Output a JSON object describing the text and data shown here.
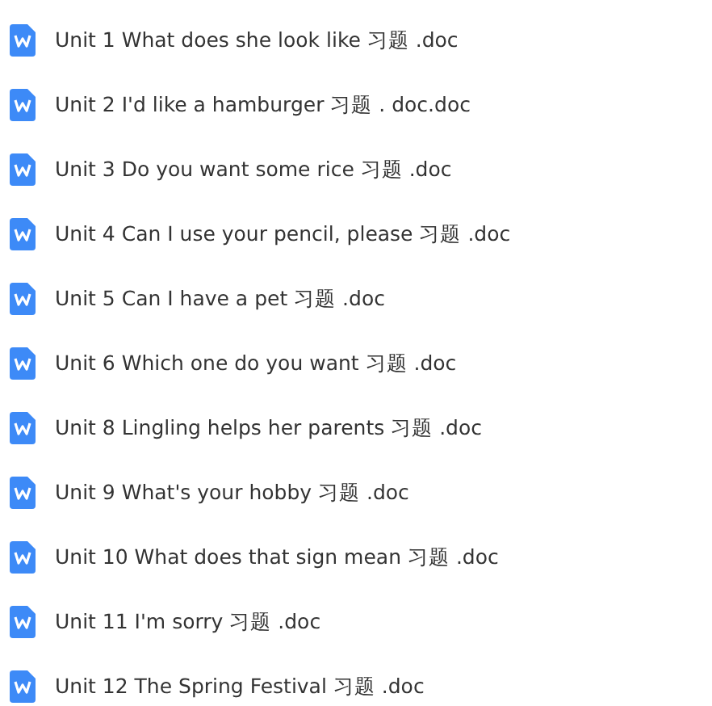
{
  "files": [
    {
      "name": "Unit 1 What does she look like 习题 .doc"
    },
    {
      "name": "Unit 2 I'd like a hamburger 习题 . doc.doc"
    },
    {
      "name": "Unit 3 Do you want some rice 习题 .doc"
    },
    {
      "name": "Unit 4 Can I use your pencil, please 习题 .doc"
    },
    {
      "name": "Unit 5 Can I have a pet 习题 .doc"
    },
    {
      "name": "Unit 6 Which one do you want 习题 .doc"
    },
    {
      "name": "Unit 8 Lingling helps her parents 习题 .doc"
    },
    {
      "name": "Unit 9 What's your hobby 习题 .doc"
    },
    {
      "name": "Unit 10 What does that sign mean 习题 .doc"
    },
    {
      "name": "Unit 11 I'm sorry 习题 .doc"
    },
    {
      "name": "Unit 12 The Spring Festival 习题 .doc"
    }
  ]
}
